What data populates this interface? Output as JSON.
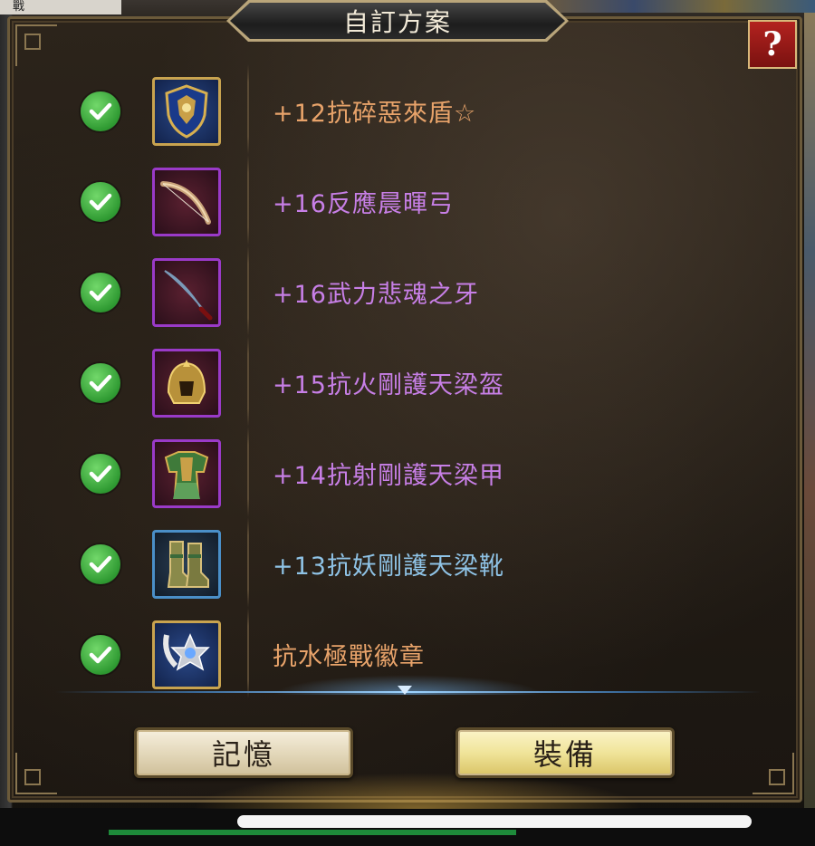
{
  "window": {
    "title": "自訂方案",
    "help_label": "?"
  },
  "background_corner_text": "戰",
  "items": [
    {
      "name": "+12抗碎惡來盾☆",
      "color": "#e8a36a",
      "frame": "gold",
      "icon": "shield-icon"
    },
    {
      "name": "+16反應晨暉弓",
      "color": "#c77fe6",
      "frame": "purple",
      "icon": "bow-icon"
    },
    {
      "name": "+16武力悲魂之牙",
      "color": "#c77fe6",
      "frame": "purple",
      "icon": "sword-icon"
    },
    {
      "name": "+15抗火剛護天梁盔",
      "color": "#c77fe6",
      "frame": "purple",
      "icon": "helmet-icon"
    },
    {
      "name": "+14抗射剛護天梁甲",
      "color": "#c77fe6",
      "frame": "purple",
      "icon": "armor-icon"
    },
    {
      "name": "+13抗妖剛護天梁靴",
      "color": "#8fc3e6",
      "frame": "blue",
      "icon": "boots-icon"
    },
    {
      "name": "抗水極戰徽章",
      "color": "#e8a36a",
      "frame": "gold",
      "icon": "badge-icon"
    }
  ],
  "buttons": {
    "memory": "記憶",
    "equip": "裝備"
  },
  "colors": {
    "check": "#3fae3a",
    "accent_gold": "#c8a34f",
    "purple": "#9a3ac8"
  }
}
